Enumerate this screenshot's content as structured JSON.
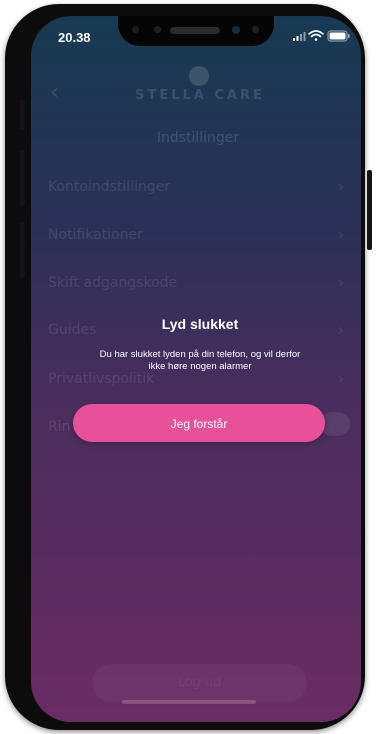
{
  "status_bar": {
    "time": "20.38"
  },
  "app": {
    "logo_text": "STELLA CARE"
  },
  "screen": {
    "title": "Indstillinger",
    "items": [
      {
        "label": "Kontoindstillinger"
      },
      {
        "label": "Notifikationer"
      },
      {
        "label": "Skift adgangskode"
      },
      {
        "label": "Guides"
      },
      {
        "label": "Privatlivspolitik"
      },
      {
        "label": "Rin"
      }
    ],
    "bottom_button_label": "Log ud"
  },
  "modal": {
    "title": "Lyd slukket",
    "message_line1": "Du har slukket lyden på din telefon, og vil derfor",
    "message_line2": "ikke høre nogen alarmer",
    "button_label": "Jeg forstår"
  },
  "colors": {
    "accent": "#e8519a",
    "gradient_top": "#173a52",
    "gradient_bottom": "#6a2c64"
  },
  "icons": [
    "back-arrow-icon",
    "chevron-right-icon",
    "signal-icon",
    "wifi-icon",
    "battery-icon",
    "logo-icon"
  ]
}
